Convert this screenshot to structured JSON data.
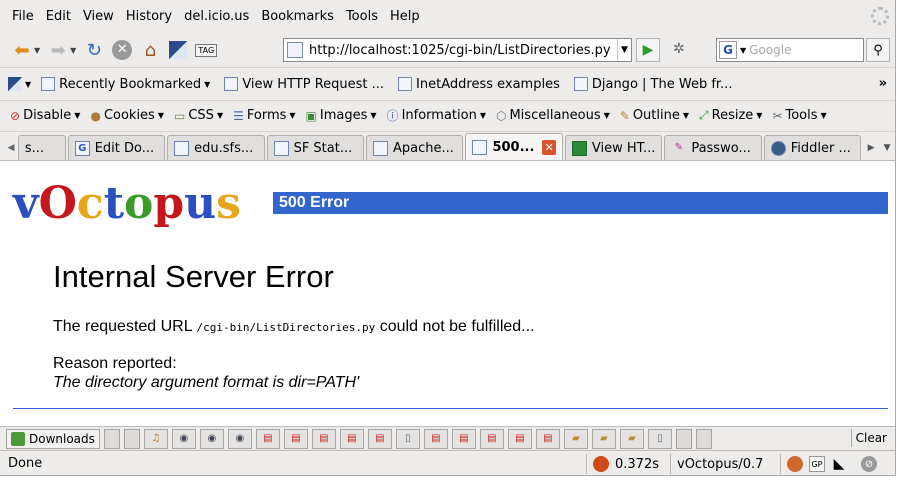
{
  "menubar": {
    "items": [
      "File",
      "Edit",
      "View",
      "History",
      "del.icio.us",
      "Bookmarks",
      "Tools",
      "Help"
    ]
  },
  "navbar": {
    "url": "http://localhost:1025/cgi-bin/ListDirectories.py",
    "search_placeholder": "Google",
    "search_engine_letter": "G",
    "tag_label": "TAG"
  },
  "bookmarks": {
    "items": [
      "Recently Bookmarked",
      "View HTTP Request ...",
      "InetAddress examples",
      "Django | The Web fr..."
    ],
    "overflow": "»"
  },
  "devtoolbar": {
    "items": [
      "Disable",
      "Cookies",
      "CSS",
      "Forms",
      "Images",
      "Information",
      "Miscellaneous",
      "Outline",
      "Resize",
      "Tools"
    ]
  },
  "tabs": {
    "items": [
      {
        "label": "s..."
      },
      {
        "label": "Edit Do..."
      },
      {
        "label": "edu.sfs..."
      },
      {
        "label": "SF Stat..."
      },
      {
        "label": "Apache..."
      },
      {
        "label": "500..."
      },
      {
        "label": "View HT..."
      },
      {
        "label": "Passwo..."
      },
      {
        "label": "Fiddler ..."
      }
    ],
    "active_index": 5
  },
  "page": {
    "logo_letters": [
      {
        "ch": "v",
        "color": "#2a4fbf"
      },
      {
        "ch": "O",
        "color": "#c4181c"
      },
      {
        "ch": "c",
        "color": "#e7a51a"
      },
      {
        "ch": "t",
        "color": "#2a4fbf"
      },
      {
        "ch": "o",
        "color": "#3a9a2a"
      },
      {
        "ch": "p",
        "color": "#c4181c"
      },
      {
        "ch": "u",
        "color": "#2a4fbf"
      },
      {
        "ch": "s",
        "color": "#e7a51a"
      }
    ],
    "banner": "500 Error",
    "title": "Internal Server Error",
    "msg_prefix": "The requested URL ",
    "msg_path": "/cgi-bin/ListDirectories.py",
    "msg_suffix": " could not be fulfilled...",
    "reason_label": "Reason reported:",
    "reason_text": "The directory argument format is dir=PATH'",
    "accent_color": "#3366cc"
  },
  "downloads": {
    "label": "Downloads",
    "clear": "Clear",
    "items": [
      "blank",
      "blank",
      "music",
      "media",
      "media",
      "media",
      "pdf",
      "pdf",
      "pdf",
      "pdf",
      "pdf",
      "doc",
      "pdf",
      "pdf",
      "pdf",
      "pdf",
      "pdf",
      "folder",
      "folder",
      "folder",
      "doc",
      "blank",
      "blank"
    ]
  },
  "statusbar": {
    "status": "Done",
    "timing": "0.372s",
    "app_version": "vOctopus/0.7",
    "gp_label": "GP"
  }
}
